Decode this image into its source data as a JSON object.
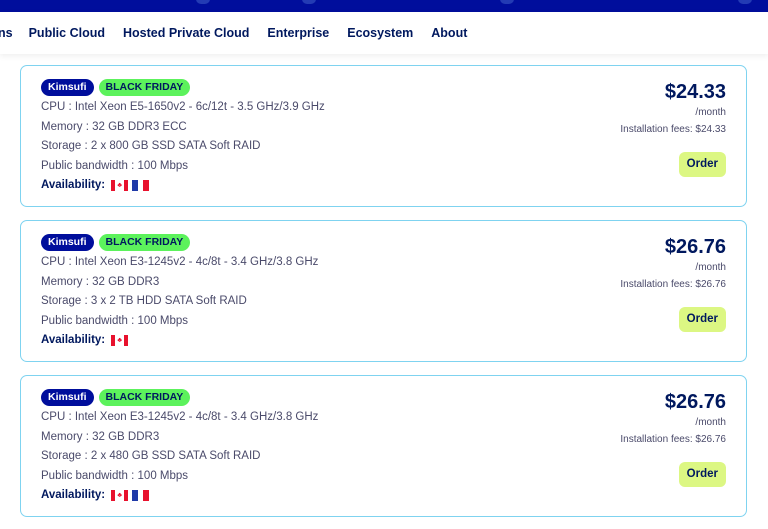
{
  "nav": {
    "items": [
      "ns",
      "Public Cloud",
      "Hosted Private Cloud",
      "Enterprise",
      "Ecosystem",
      "About"
    ]
  },
  "offers": [
    {
      "brand": "Kimsufi",
      "promo": "BLACK FRIDAY",
      "cpu": "CPU : Intel Xeon E5-1650v2 - 6c/12t - 3.5 GHz/3.9 GHz",
      "memory": "Memory : 32 GB DDR3 ECC",
      "storage": "Storage : 2 x 800 GB SSD SATA Soft RAID",
      "bandwidth": "Public bandwidth : 100 Mbps",
      "availability_label": "Availability:",
      "availability": [
        "canada-flag",
        "france-flag"
      ],
      "price": "$24.33",
      "period": "/month",
      "fees": "Installation fees: $24.33",
      "order_label": "Order"
    },
    {
      "brand": "Kimsufi",
      "promo": "BLACK FRIDAY",
      "cpu": "CPU : Intel Xeon E3-1245v2 - 4c/8t - 3.4 GHz/3.8 GHz",
      "memory": "Memory : 32 GB DDR3",
      "storage": "Storage : 3 x 2 TB HDD SATA Soft RAID",
      "bandwidth": "Public bandwidth : 100 Mbps",
      "availability_label": "Availability:",
      "availability": [
        "canada-flag"
      ],
      "price": "$26.76",
      "period": "/month",
      "fees": "Installation fees: $26.76",
      "order_label": "Order"
    },
    {
      "brand": "Kimsufi",
      "promo": "BLACK FRIDAY",
      "cpu": "CPU : Intel Xeon E3-1245v2 - 4c/8t - 3.4 GHz/3.8 GHz",
      "memory": "Memory : 32 GB DDR3",
      "storage": "Storage : 2 x 480 GB SSD SATA Soft RAID",
      "bandwidth": "Public bandwidth : 100 Mbps",
      "availability_label": "Availability:",
      "availability": [
        "canada-flag",
        "france-flag"
      ],
      "price": "$26.76",
      "period": "/month",
      "fees": "Installation fees: $26.76",
      "order_label": "Order"
    }
  ],
  "colors": {
    "header_bg": "#000e9c",
    "brand_badge": "#000e9c",
    "promo_badge": "#5cf25c",
    "order_button": "#dcf783",
    "card_border": "#7fd3f0",
    "price_text": "#00185e"
  }
}
